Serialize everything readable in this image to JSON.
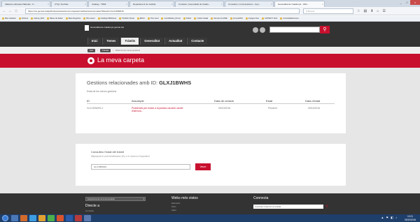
{
  "browser": {
    "tabs": [
      {
        "label": "Valleras Lafunasa d'Elestas - K..."
      },
      {
        "label": "CTQ | Fuchats"
      },
      {
        "label": "Catalog - TRMI"
      },
      {
        "label": "Departament de Justicia"
      },
      {
        "label": "Contacte | Generalitat de Catalu..."
      },
      {
        "label": "Consultes i comunicacions - Gen..."
      },
      {
        "label": "Generalitat de Catalunya - Ofici..."
      }
    ],
    "url": "https://ovt.gencat.cat/gsitfc/AppJava/ca/common/gestio/notificacions/consultes?idGestio=GLXJ1BWHS",
    "search_placeholder": "Q Buscar",
    "bookmarks": [
      "Más visitados",
      "Adreces",
      "Adreça_Web",
      "Bases de dades",
      "Base Registres",
      "Bio-Lexent",
      "Catálogo Biblioteca",
      "Portfolio Virtual",
      "EDUC",
      "Proc.nivel",
      "Com/Mobles_PLCat",
      "Twitter",
      "Institut Català",
      "Serveis CLASSE",
      "Cursos2016",
      "Imatges Free",
      "CAPSETT HCA",
      "CronicalafasCorma"
    ],
    "window_controls": [
      "_",
      "□",
      "×"
    ],
    "toolbar_icons": [
      "☆",
      "▤",
      "⬇",
      "⌂",
      "☰"
    ]
  },
  "site": {
    "logo_text": "Generalitat de Catalunya gencat.cat",
    "menu": [
      "Inici",
      "Temes",
      "Tràmits",
      "Generalitat",
      "Actualitat",
      "Contacte"
    ],
    "breadcrumbs": [
      "Inici",
      "Tràmits"
    ],
    "breadcrumb_current": "Estat de les meves gestions"
  },
  "banner_title": "La meva carpeta",
  "gestions": {
    "title_prefix": "Gestions relacionades amb ID:",
    "title_id": "GLXJ1BWHS",
    "subtitle": "Estat de les meves gestions",
    "columns": [
      "ID",
      "Assumpte",
      "Data de creació",
      "Estat",
      "Data d'estat"
    ],
    "rows": [
      {
        "id": "GLXJ1BWHS-1",
        "subject": "Problemes per enviar a la justícia cat amb carnet d'advoca...",
        "created": "05/10/2016",
        "status": "Pendent",
        "status_date": "05/10/2016"
      }
    ]
  },
  "consulta": {
    "title": "Consulteu l'estat del tràmit",
    "hint": "Mitjançant el codi identificador (ID) o el número d'expedient",
    "input_value": "GLXJ1BWHS",
    "button": "Veure"
  },
  "footer": {
    "select": "Departaments de la Generalitat",
    "col1_title": "Directe a",
    "col1_links": [
      "Cercador"
    ],
    "col2_title": "Webs més vistos",
    "col2_links": [
      "Educació",
      "SOC",
      "Salut"
    ],
    "col3_title": "Connecta",
    "connecta_input": "Consultes d'atenció al ciutadà"
  },
  "taskbar": {
    "time": "10:21",
    "date": "05/10/2016",
    "tray": "▲ ⚑ ◧ ♪"
  },
  "colors": {
    "accent": "#c8102e",
    "header": "#333333",
    "page_bg": "#e6e6e6"
  }
}
